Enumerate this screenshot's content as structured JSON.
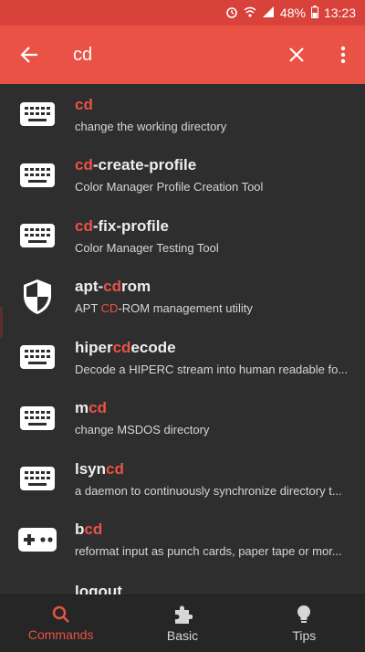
{
  "status_bar": {
    "battery_percent": "48%",
    "time": "13:23",
    "icons": [
      "alarm-icon",
      "wifi-icon",
      "signal-icon",
      "battery-icon"
    ]
  },
  "search": {
    "value": "cd",
    "icons": {
      "back": "arrow-left-icon",
      "clear": "close-icon",
      "more": "more-vert-icon"
    }
  },
  "results": [
    {
      "pre": "",
      "match": "cd",
      "post": "",
      "desc_pre": "change the working directory",
      "desc_match": "",
      "desc_post": "",
      "icon": "keyboard-icon"
    },
    {
      "pre": "",
      "match": "cd",
      "post": "-create-profile",
      "desc_pre": "Color Manager Profile Creation Tool",
      "desc_match": "",
      "desc_post": "",
      "icon": "keyboard-icon"
    },
    {
      "pre": "",
      "match": "cd",
      "post": "-fix-profile",
      "desc_pre": "Color Manager Testing Tool",
      "desc_match": "",
      "desc_post": "",
      "icon": "keyboard-icon"
    },
    {
      "pre": "apt-",
      "match": "cd",
      "post": "rom",
      "desc_pre": "APT ",
      "desc_match": "CD",
      "desc_post": "-ROM management utility",
      "icon": "shield-icon"
    },
    {
      "pre": "hiper",
      "match": "cd",
      "post": "ecode",
      "desc_pre": "Decode a HIPERC stream into human readable fo...",
      "desc_match": "",
      "desc_post": "",
      "icon": "keyboard-icon"
    },
    {
      "pre": "m",
      "match": "cd",
      "post": "",
      "desc_pre": "change MSDOS directory",
      "desc_match": "",
      "desc_post": "",
      "icon": "keyboard-icon"
    },
    {
      "pre": "lsyn",
      "match": "cd",
      "post": "",
      "desc_pre": "a daemon to continuously synchronize directory t...",
      "desc_match": "",
      "desc_post": "",
      "icon": "keyboard-icon"
    },
    {
      "pre": "b",
      "match": "cd",
      "post": "",
      "desc_pre": "reformat input as punch cards, paper tape or mor...",
      "desc_match": "",
      "desc_post": "",
      "icon": "gamepad-icon"
    },
    {
      "pre": "logout",
      "match": "",
      "post": "",
      "desc_pre": "",
      "desc_match": "",
      "desc_post": "",
      "icon": "keyboard-icon"
    }
  ],
  "bottom_nav": [
    {
      "label": "Commands",
      "icon": "search-icon",
      "active": true
    },
    {
      "label": "Basic",
      "icon": "puzzle-icon",
      "active": false
    },
    {
      "label": "Tips",
      "icon": "lightbulb-icon",
      "active": false
    }
  ],
  "colors": {
    "accent": "#ea5245",
    "status_bar": "#d8423a",
    "background": "#2e2e2e",
    "bottom_nav": "#262626"
  }
}
